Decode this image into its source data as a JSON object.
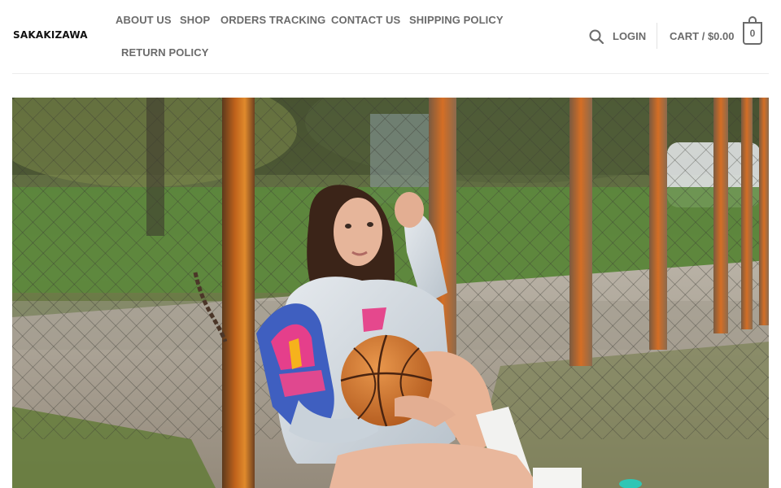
{
  "header": {
    "logo_text": "SAKAKIZAWA",
    "nav": [
      {
        "label": "ABOUT US"
      },
      {
        "label": "SHOP"
      },
      {
        "label": "ORDERS TRACKING"
      },
      {
        "label": "CONTACT US"
      },
      {
        "label": "SHIPPING POLICY"
      },
      {
        "label": "RETURN POLICY"
      }
    ],
    "login_label": "LOGIN",
    "cart_label": "CART / $0.00",
    "cart_count": "0"
  },
  "icons": {
    "search": "search-icon",
    "cart": "cart-bag-icon"
  },
  "colors": {
    "nav_text": "#6b6b6b",
    "logo": "#111111",
    "border": "#ececec"
  }
}
